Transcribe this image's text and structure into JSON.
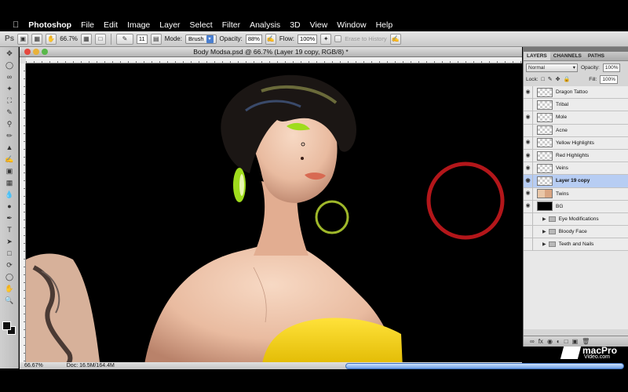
{
  "menubar": {
    "app": "Photoshop",
    "items": [
      "File",
      "Edit",
      "Image",
      "Layer",
      "Select",
      "Filter",
      "Analysis",
      "3D",
      "View",
      "Window",
      "Help"
    ]
  },
  "options": {
    "ps": "Ps",
    "zoom": "66.7%",
    "brush_size": "11",
    "mode_label": "Mode:",
    "mode_value": "Brush",
    "opacity_label": "Opacity:",
    "opacity_value": "88%",
    "flow_label": "Flow:",
    "flow_value": "100%",
    "erase_history": "Erase to History"
  },
  "document": {
    "title": "Body Modsa.psd @ 66.7% (Layer 19 copy, RGB/8) *"
  },
  "status": {
    "zoom": "66.67%",
    "doc": "Doc: 16.5M/164.4M"
  },
  "layers_panel": {
    "tabs": [
      "LAYERS",
      "CHANNELS",
      "PATHS"
    ],
    "blend_mode": "Normal",
    "opacity_label": "Opacity:",
    "opacity_value": "100%",
    "lock_label": "Lock:",
    "fill_label": "Fill:",
    "fill_value": "100%",
    "layers": [
      {
        "name": "Dragon Tattoo",
        "visible": true,
        "thumb": "transparent"
      },
      {
        "name": "Tribal",
        "visible": false,
        "thumb": "transparent"
      },
      {
        "name": "Mole",
        "visible": true,
        "thumb": "transparent"
      },
      {
        "name": "Acne",
        "visible": false,
        "thumb": "transparent"
      },
      {
        "name": "Yellow Highlights",
        "visible": true,
        "thumb": "transparent"
      },
      {
        "name": "Red Highlights",
        "visible": true,
        "thumb": "transparent"
      },
      {
        "name": "Veins",
        "visible": true,
        "thumb": "transparent"
      },
      {
        "name": "Layer 19 copy",
        "visible": true,
        "thumb": "transparent",
        "selected": true
      },
      {
        "name": "Twins",
        "visible": true,
        "thumb": "twins"
      },
      {
        "name": "BG",
        "visible": true,
        "thumb": "black"
      },
      {
        "name": "Eye Modifications",
        "visible": false,
        "thumb": "folder"
      },
      {
        "name": "Bloody Face",
        "visible": false,
        "thumb": "folder"
      },
      {
        "name": "Teeth and Nails",
        "visible": false,
        "thumb": "folder"
      }
    ]
  },
  "watermark": {
    "brand": "macPro",
    "site": "Video.com"
  },
  "colors": {
    "selected_layer": "#b7cdf3",
    "brush_ring": "#b3161a",
    "shirt": "#f1d000",
    "eyeshadow": "#9fdc1c"
  }
}
